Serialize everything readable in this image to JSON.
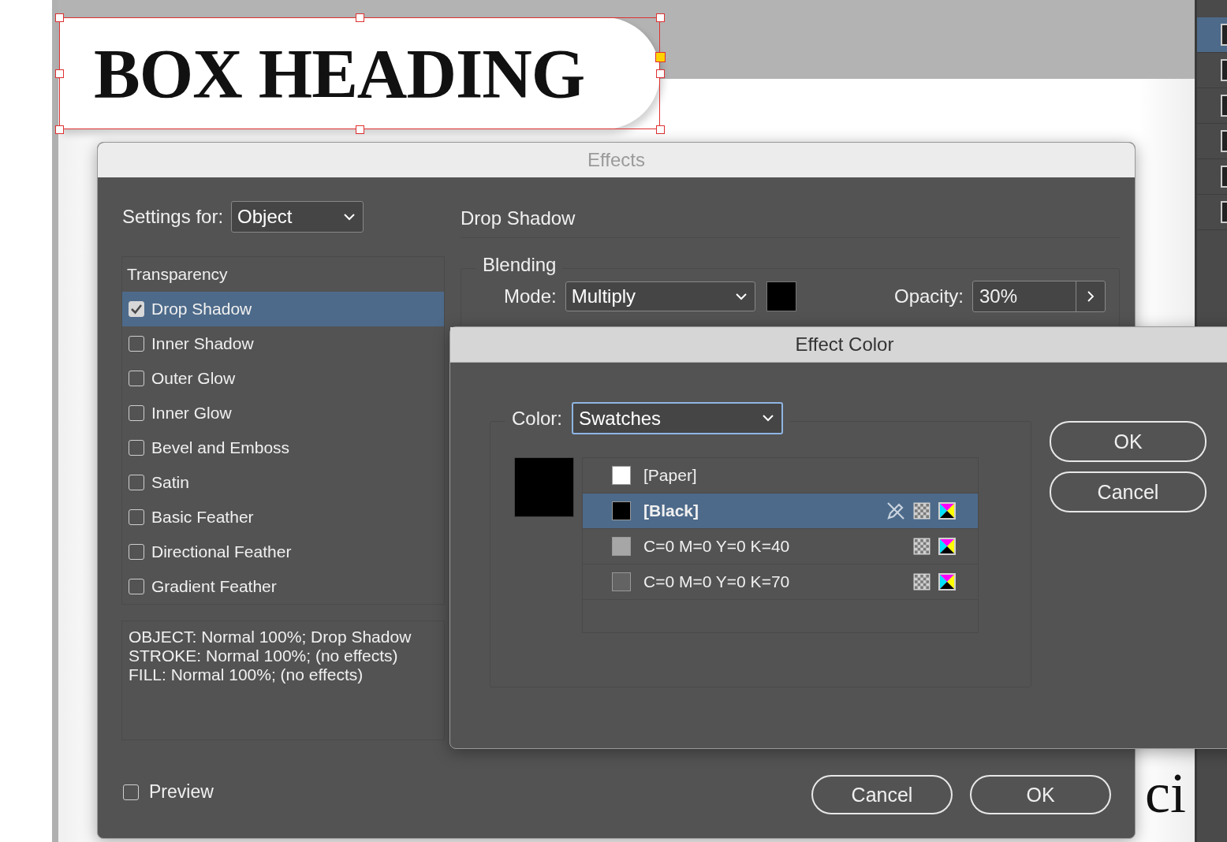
{
  "document": {
    "heading": "BOX HEADING",
    "text_fragments": [
      {
        "text": "ci",
        "kind": "lower"
      }
    ]
  },
  "side_panel": {
    "rows": [
      {
        "selected": true
      },
      {
        "selected": false
      },
      {
        "selected": false
      },
      {
        "selected": false
      },
      {
        "selected": false
      },
      {
        "selected": false
      }
    ]
  },
  "effects_dialog": {
    "title": "Effects",
    "settings_for": {
      "label": "Settings for:",
      "value": "Object"
    },
    "effects_list": {
      "header": "Transparency",
      "items": [
        {
          "label": "Drop Shadow",
          "checked": true,
          "selected": true
        },
        {
          "label": "Inner Shadow",
          "checked": false,
          "selected": false
        },
        {
          "label": "Outer Glow",
          "checked": false,
          "selected": false
        },
        {
          "label": "Inner Glow",
          "checked": false,
          "selected": false
        },
        {
          "label": "Bevel and Emboss",
          "checked": false,
          "selected": false
        },
        {
          "label": "Satin",
          "checked": false,
          "selected": false
        },
        {
          "label": "Basic Feather",
          "checked": false,
          "selected": false
        },
        {
          "label": "Directional Feather",
          "checked": false,
          "selected": false
        },
        {
          "label": "Gradient Feather",
          "checked": false,
          "selected": false
        }
      ]
    },
    "summary": [
      "OBJECT: Normal 100%; Drop Shadow",
      "STROKE: Normal 100%; (no effects)",
      "FILL: Normal 100%; (no effects)"
    ],
    "preview": {
      "label": "Preview",
      "checked": false
    },
    "section_title": "Drop Shadow",
    "blending": {
      "title": "Blending",
      "mode_label": "Mode:",
      "mode": "Multiply",
      "opacity_label": "Opacity:",
      "opacity": "30%"
    },
    "buttons": [
      {
        "label": "Cancel"
      },
      {
        "label": "OK"
      }
    ]
  },
  "effect_color_dialog": {
    "title": "Effect Color",
    "color_label": "Color:",
    "color_mode": "Swatches",
    "swatches": [
      {
        "name": "[Paper]",
        "color": "#ffffff",
        "selected": false,
        "locked": false,
        "process": false
      },
      {
        "name": "[Black]",
        "color": "#000000",
        "selected": true,
        "locked": true,
        "process": true
      },
      {
        "name": "C=0 M=0 Y=0 K=40",
        "color": "#a6a6a6",
        "selected": false,
        "locked": false,
        "process": true
      },
      {
        "name": "C=0 M=0 Y=0 K=70",
        "color": "#636363",
        "selected": false,
        "locked": false,
        "process": true
      }
    ],
    "buttons": [
      {
        "label": "OK"
      },
      {
        "label": "Cancel"
      }
    ]
  }
}
